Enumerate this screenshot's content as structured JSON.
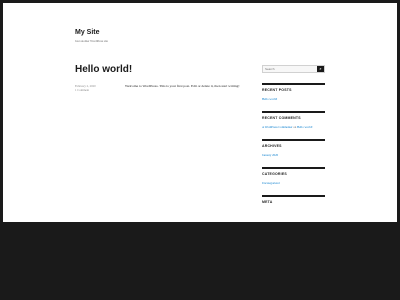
{
  "site": {
    "title": "My Site",
    "description": "Just another WordPress site"
  },
  "post": {
    "title": "Hello world!",
    "date": "February 2, 2020",
    "comments": "1 Comment",
    "body": "Welcome to WordPress. This is your first post. Edit or delete it, then start writing!"
  },
  "sidebar": {
    "search": {
      "placeholder": "Search",
      "button": "⌕"
    },
    "recent_posts": {
      "title": "RECENT POSTS",
      "items": [
        "Hello world!"
      ]
    },
    "recent_comments": {
      "title": "RECENT COMMENTS",
      "author": "A WordPress Commenter",
      "connector": "on",
      "post": "Hello world!"
    },
    "archives": {
      "title": "ARCHIVES",
      "items": [
        "January 2020"
      ]
    },
    "categories": {
      "title": "CATEGORIES",
      "items": [
        "Uncategorized"
      ]
    },
    "meta": {
      "title": "META"
    }
  },
  "colors": {
    "link": "#007acc",
    "text": "#1a1a1a",
    "frame": "#1a1a1a"
  }
}
